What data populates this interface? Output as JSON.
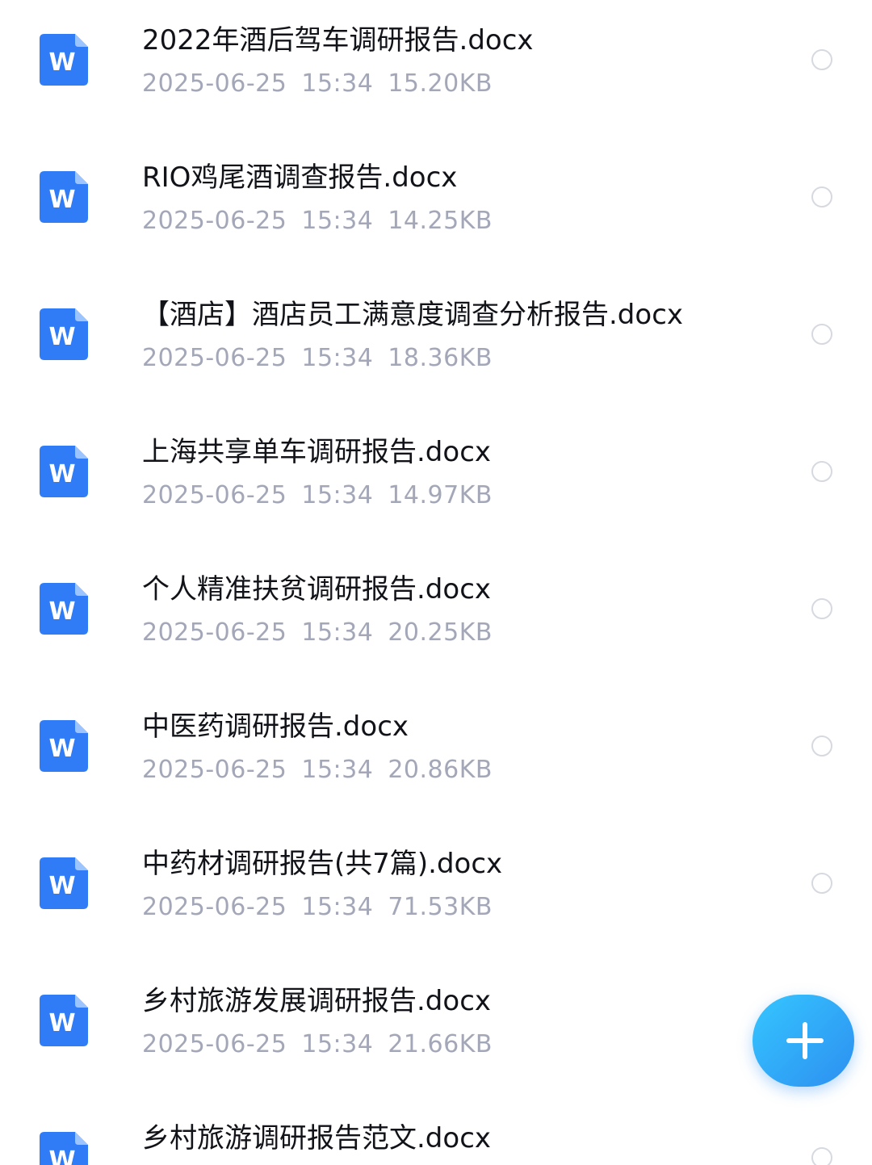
{
  "files": [
    {
      "name": "2022年酒后驾车调研报告.docx",
      "date": "2025-06-25",
      "time": "15:34",
      "size": "15.20KB"
    },
    {
      "name": "RIO鸡尾酒调查报告.docx",
      "date": "2025-06-25",
      "time": "15:34",
      "size": "14.25KB"
    },
    {
      "name": "【酒店】酒店员工满意度调查分析报告.docx",
      "date": "2025-06-25",
      "time": "15:34",
      "size": "18.36KB"
    },
    {
      "name": "上海共享单车调研报告.docx",
      "date": "2025-06-25",
      "time": "15:34",
      "size": "14.97KB"
    },
    {
      "name": "个人精准扶贫调研报告.docx",
      "date": "2025-06-25",
      "time": "15:34",
      "size": "20.25KB"
    },
    {
      "name": "中医药调研报告.docx",
      "date": "2025-06-25",
      "time": "15:34",
      "size": "20.86KB"
    },
    {
      "name": "中药材调研报告(共7篇).docx",
      "date": "2025-06-25",
      "time": "15:34",
      "size": "71.53KB"
    },
    {
      "name": "乡村旅游发展调研报告.docx",
      "date": "2025-06-25",
      "time": "15:34",
      "size": "21.66KB"
    },
    {
      "name": "乡村旅游调研报告范文.docx",
      "date": "",
      "time": "",
      "size": ""
    }
  ],
  "icons": {
    "file_type": "word-doc-icon",
    "file_letter": "W",
    "fab": "plus-icon"
  },
  "colors": {
    "word_icon": "#2f7cf6",
    "fab_start": "#35c6ff",
    "fab_end": "#2d8ff0",
    "meta_text": "#a3a7b8",
    "name_text": "#111318"
  }
}
